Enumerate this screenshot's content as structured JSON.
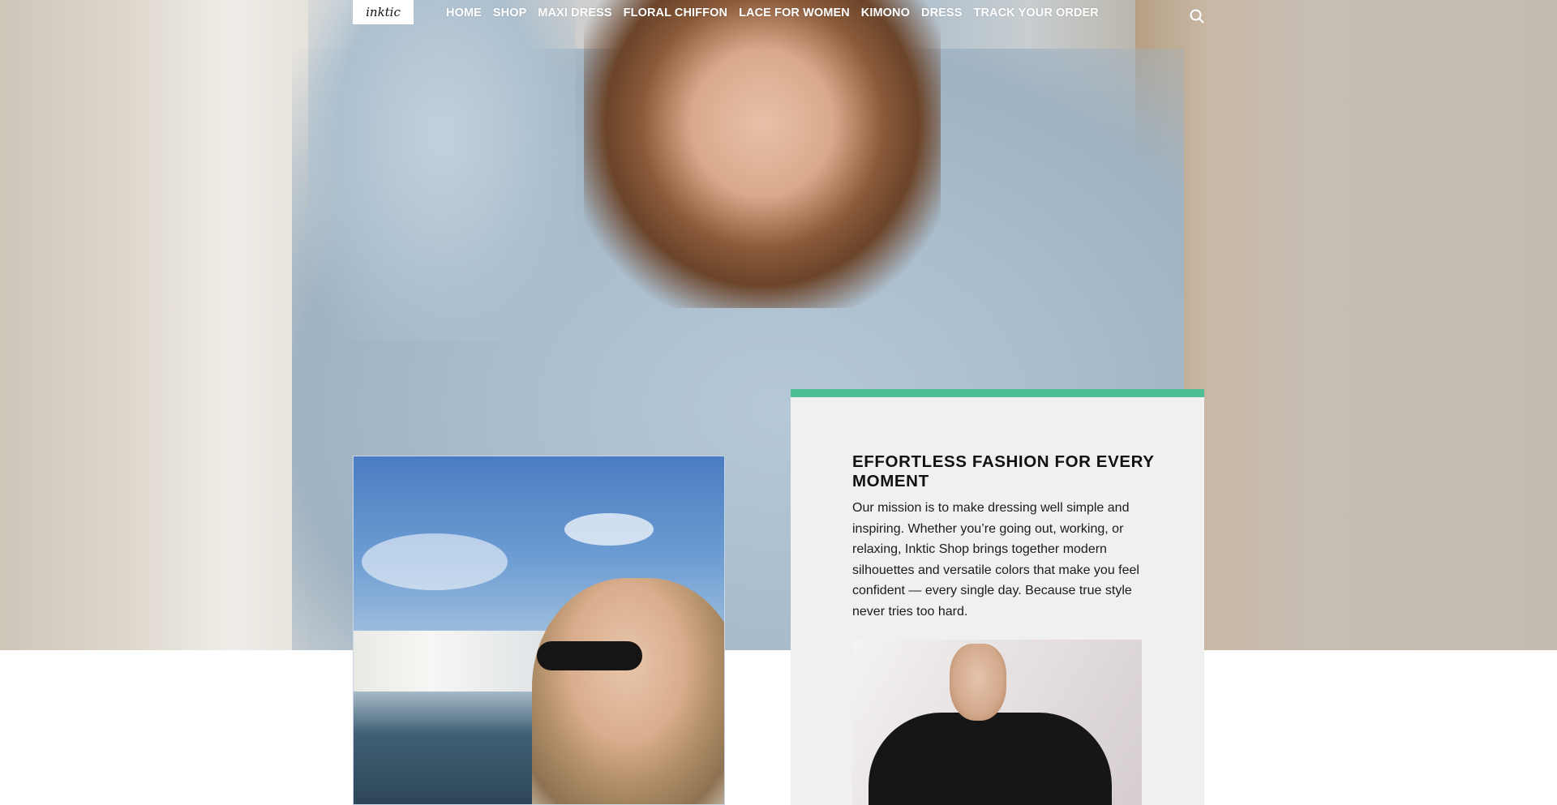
{
  "header": {
    "logo_text": "inktic",
    "nav": [
      {
        "label": "HOME"
      },
      {
        "label": "SHOP"
      },
      {
        "label": "MAXI DRESS"
      },
      {
        "label": "FLORAL CHIFFON"
      },
      {
        "label": "LACE FOR WOMEN"
      },
      {
        "label": "KIMONO"
      },
      {
        "label": "DRESS"
      },
      {
        "label": "TRACK YOUR ORDER"
      }
    ],
    "search_icon": "search-icon"
  },
  "card": {
    "accent_color": "#4cbf95",
    "title": "EFFORTLESS FASHION FOR EVERY MOMENT",
    "body": "Our mission is to make dressing well simple and inspiring. Whether you’re going out, working, or relaxing, Inktic Shop brings together modern silhouettes and versatile colors that make you feel confident — every single day. Because true style never tries too hard."
  }
}
